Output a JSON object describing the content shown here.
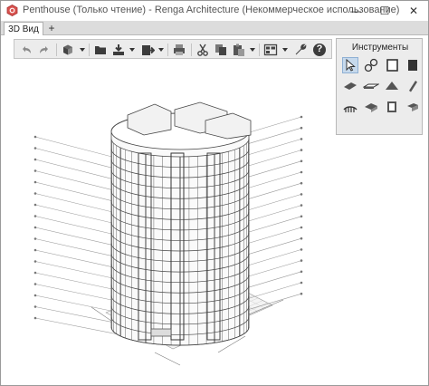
{
  "window": {
    "title": "Penthouse (Только чтение) - Renga Architecture (Некоммерческое использование)",
    "minimize_symbol": "—",
    "maximize_symbol": "☐",
    "close_symbol": "✕"
  },
  "tabs": [
    {
      "label": "3D Вид",
      "active": true
    }
  ],
  "tab_add_symbol": "+",
  "toolbar": {
    "buttons": [
      "undo-icon",
      "redo-icon",
      "view-cube-icon",
      "open-folder-icon",
      "import-icon",
      "export-icon",
      "print-icon",
      "cut-icon",
      "copy-icon",
      "paste-icon",
      "views-icon",
      "settings-wrench-icon",
      "help-icon"
    ],
    "help_symbol": "?"
  },
  "tools_panel": {
    "title": "Инструменты",
    "tools": [
      "select-icon",
      "axes-icon",
      "wall-icon",
      "floor-icon",
      "beam-icon",
      "slab-icon",
      "roof-icon",
      "column-icon",
      "stair-icon",
      "railing-icon",
      "window-icon",
      "door-icon"
    ]
  },
  "colors": {
    "titlebar": "#ffffff",
    "tabbar": "#dcdcdc",
    "toolbar": "#ececec",
    "panel": "#ececec",
    "active_tool": "#c6d9ec",
    "model_line": "#444444",
    "grid_line": "#9a9a9a",
    "ground_fill": "#f4f4f4"
  }
}
